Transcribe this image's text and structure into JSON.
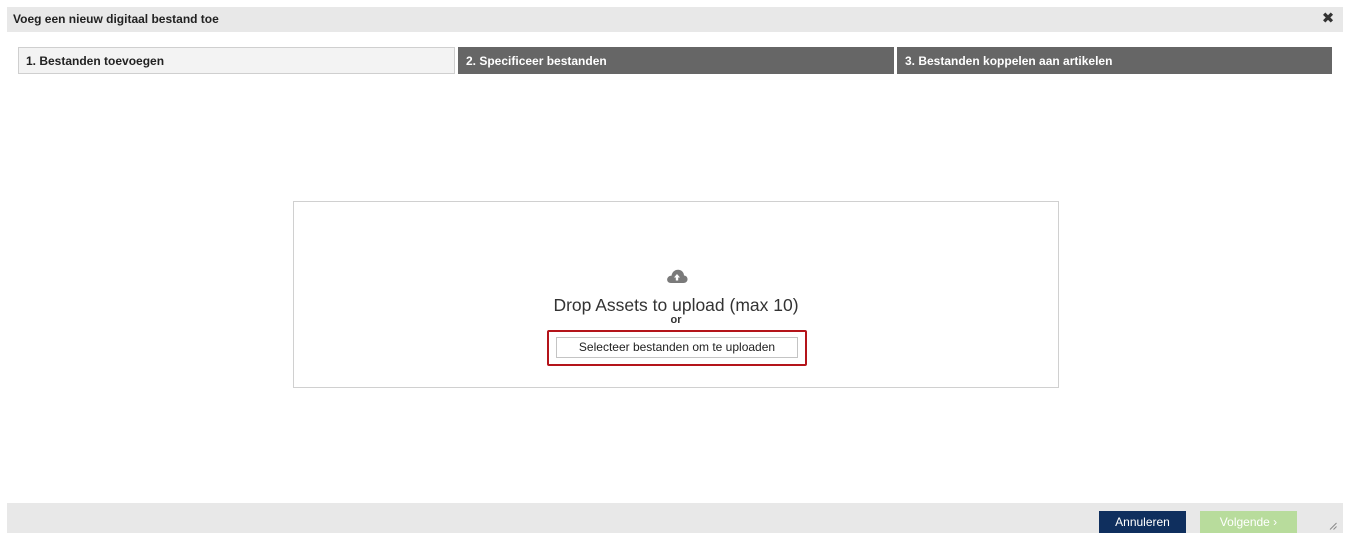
{
  "dialog": {
    "title": "Voeg een nieuw digitaal bestand toe",
    "close_icon": "close-icon"
  },
  "steps": [
    {
      "label": "1. Bestanden toevoegen",
      "state": "active"
    },
    {
      "label": "2. Specificeer bestanden",
      "state": "inactive"
    },
    {
      "label": "3. Bestanden koppelen aan artikelen",
      "state": "inactive"
    }
  ],
  "dropzone": {
    "icon": "cloud-upload-icon",
    "text": "Drop Assets to upload (max 10)",
    "or": "or",
    "select_button": "Selecteer bestanden om te uploaden"
  },
  "footer": {
    "cancel_label": "Annuleren",
    "next_label": "Volgende  ›",
    "next_enabled": false
  },
  "colors": {
    "cancel_bg": "#0f2f5e",
    "next_bg_disabled": "#b8dc9c",
    "step_inactive_bg": "#666666",
    "highlight_border": "#b4141a"
  }
}
